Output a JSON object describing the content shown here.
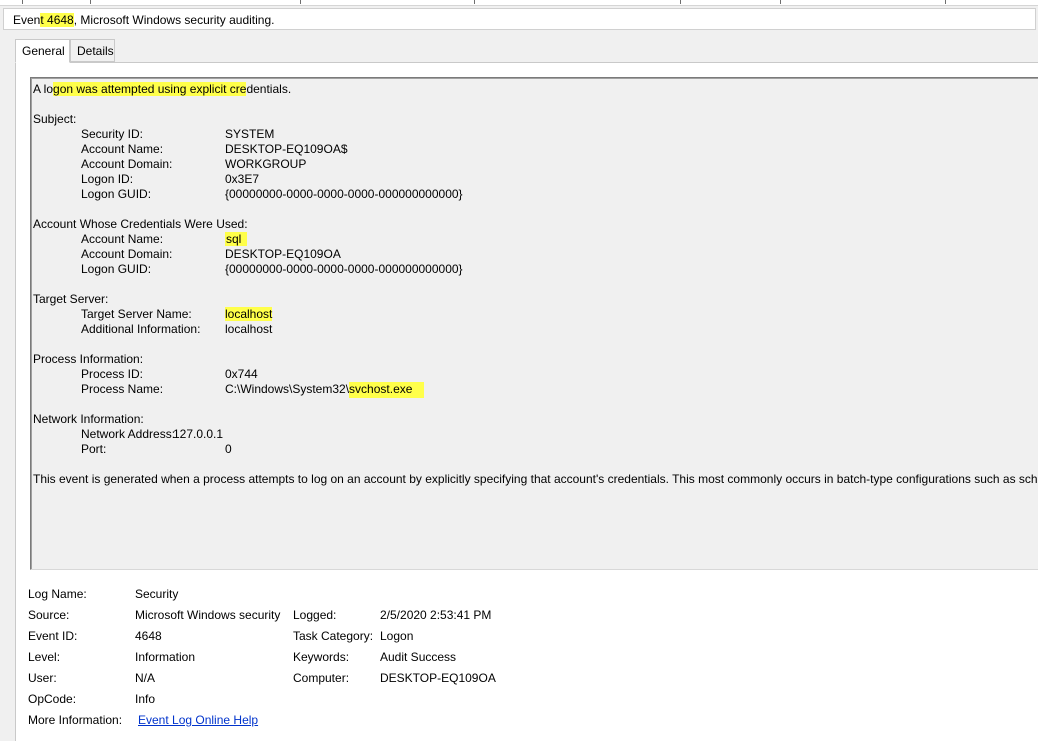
{
  "title": {
    "prefix": "Even",
    "highlight": "t 4648",
    "rest": ", Microsoft Windows security auditing."
  },
  "tabs": [
    {
      "label": "General",
      "active": true
    },
    {
      "label": "Details",
      "active": false
    }
  ],
  "description": {
    "intro": {
      "pre": "A lo",
      "highlight": "gon was attempted using explicit cre",
      "post": "dentials."
    },
    "subject": {
      "header": "Subject:",
      "security_id_label": "Security ID:",
      "security_id": "SYSTEM",
      "account_name_label": "Account Name:",
      "account_name": "DESKTOP-EQ109OA$",
      "account_domain_label": "Account Domain:",
      "account_domain": "WORKGROUP",
      "logon_id_label": "Logon ID:",
      "logon_id": "0x3E7",
      "logon_guid_label": "Logon GUID:",
      "logon_guid": "{00000000-0000-0000-0000-000000000000}"
    },
    "credentials": {
      "header": "Account Whose Credentials Were Used:",
      "account_name_label": "Account Name:",
      "account_name": "sql",
      "account_domain_label": "Account Domain:",
      "account_domain": "DESKTOP-EQ109OA",
      "logon_guid_label": "Logon GUID:",
      "logon_guid": "{00000000-0000-0000-0000-000000000000}"
    },
    "target": {
      "header": "Target Server:",
      "server_name_label": "Target Server Name:",
      "server_name": "localhost",
      "additional_label": "Additional Information:",
      "additional": "localhost"
    },
    "process": {
      "header": "Process Information:",
      "id_label": "Process ID:",
      "id": "0x744",
      "name_label": "Process Name:",
      "name_pre": "C:\\Windows\\System32\\",
      "name_highlight": "svchost.exe"
    },
    "network": {
      "header": "Network Information:",
      "address_label": "Network Address:",
      "address": "127.0.0.1",
      "port_label": "Port:",
      "port": "0"
    },
    "footer": "This event is generated when a process attempts to log on an account by explicitly specifying that account's credentials.  This most commonly occurs in batch-type configurations such as sch"
  },
  "meta": {
    "log_name_label": "Log Name:",
    "log_name": "Security",
    "source_label": "Source:",
    "source": "Microsoft Windows security",
    "logged_label": "Logged:",
    "logged": "2/5/2020 2:53:41 PM",
    "event_id_label": "Event ID:",
    "event_id": "4648",
    "task_category_label": "Task Category:",
    "task_category": "Logon",
    "level_label": "Level:",
    "level": "Information",
    "keywords_label": "Keywords:",
    "keywords": "Audit Success",
    "user_label": "User:",
    "user": "N/A",
    "computer_label": "Computer:",
    "computer": "DESKTOP-EQ109OA",
    "opcode_label": "OpCode:",
    "opcode": "Info",
    "more_info_label": "More Information:",
    "more_info_link": "Event Log Online Help"
  },
  "colors": {
    "highlight": "#ffff4a",
    "link": "#0033cc"
  }
}
